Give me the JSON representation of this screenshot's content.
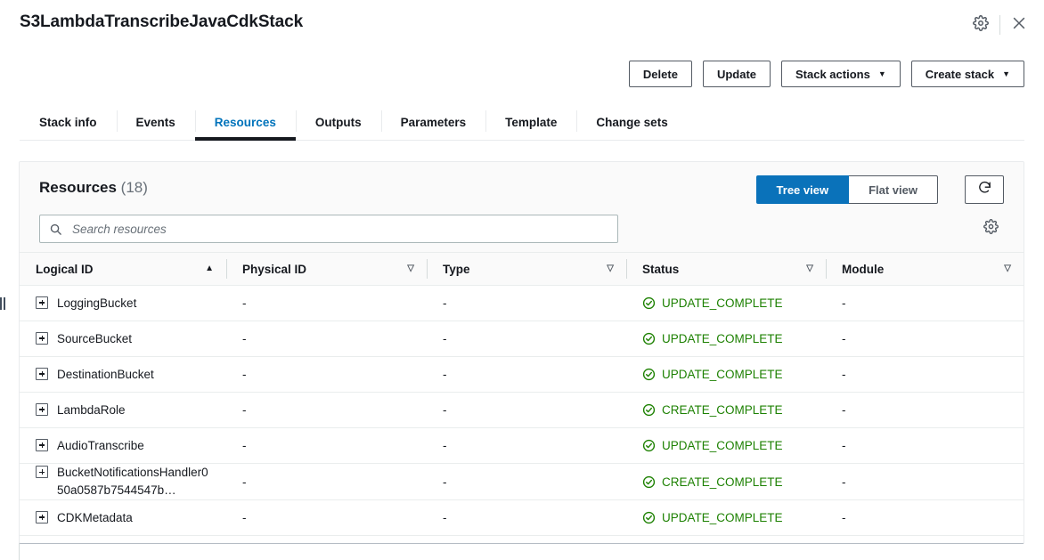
{
  "header": {
    "stack_title": "S3LambdaTranscribeJavaCdkStack",
    "settings_icon": "gear-icon",
    "close_icon": "close-icon"
  },
  "actions": [
    {
      "label": "Delete",
      "caret": ""
    },
    {
      "label": "Update",
      "caret": ""
    },
    {
      "label": "Stack actions",
      "caret": "▼"
    },
    {
      "label": "Create stack",
      "caret": "▼"
    }
  ],
  "tabs": [
    {
      "label": "Stack info",
      "active": false
    },
    {
      "label": "Events",
      "active": false
    },
    {
      "label": "Resources",
      "active": true
    },
    {
      "label": "Outputs",
      "active": false
    },
    {
      "label": "Parameters",
      "active": false
    },
    {
      "label": "Template",
      "active": false
    },
    {
      "label": "Change sets",
      "active": false
    }
  ],
  "panel": {
    "title": "Resources",
    "count": "(18)",
    "view_toggle": {
      "tree_label": "Tree view",
      "flat_label": "Flat view",
      "selected": "Tree view"
    },
    "refresh_icon": "refresh-icon",
    "preferences_icon": "gear-icon",
    "search": {
      "value": "",
      "placeholder": "Search resources",
      "icon": "search-icon"
    },
    "columns": [
      {
        "label": "Logical ID",
        "sort": "asc"
      },
      {
        "label": "Physical ID",
        "sort": "none"
      },
      {
        "label": "Type",
        "sort": "none"
      },
      {
        "label": "Status",
        "sort": "none"
      },
      {
        "label": "Module",
        "sort": "none"
      }
    ],
    "rows": [
      {
        "logical_id": "LoggingBucket",
        "physical_id": "-",
        "type": "-",
        "status": "UPDATE_COMPLETE",
        "module": "-",
        "wrapped": false
      },
      {
        "logical_id": "SourceBucket",
        "physical_id": "-",
        "type": "-",
        "status": "UPDATE_COMPLETE",
        "module": "-",
        "wrapped": false
      },
      {
        "logical_id": "DestinationBucket",
        "physical_id": "-",
        "type": "-",
        "status": "UPDATE_COMPLETE",
        "module": "-",
        "wrapped": false
      },
      {
        "logical_id": "LambdaRole",
        "physical_id": "-",
        "type": "-",
        "status": "CREATE_COMPLETE",
        "module": "-",
        "wrapped": false
      },
      {
        "logical_id": "AudioTranscribe",
        "physical_id": "-",
        "type": "-",
        "status": "UPDATE_COMPLETE",
        "module": "-",
        "wrapped": false
      },
      {
        "logical_id": "BucketNotificationsHandler050a0587b7544547b…",
        "physical_id": "-",
        "type": "-",
        "status": "CREATE_COMPLETE",
        "module": "-",
        "wrapped": true
      },
      {
        "logical_id": "CDKMetadata",
        "physical_id": "-",
        "type": "-",
        "status": "UPDATE_COMPLETE",
        "module": "-",
        "wrapped": false
      }
    ]
  },
  "colors": {
    "accent_blue": "#0a72ba",
    "tab_blue": "#0073bb",
    "status_green": "#1d8102",
    "border": "#e9ebed",
    "text": "#16191f",
    "muted_text": "#687078"
  }
}
